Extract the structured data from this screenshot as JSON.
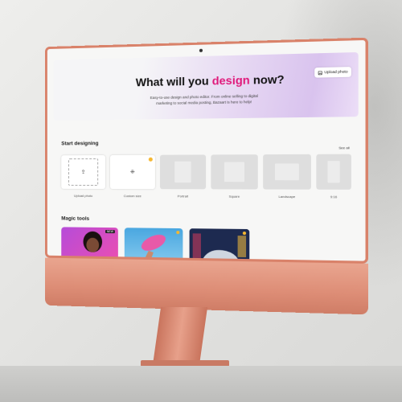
{
  "hero": {
    "title_before": "What will you ",
    "title_accent": "design",
    "title_after": " now?",
    "subtitle": "Easy-to-use design and photo editor. From online selling to digital marketing to social media posting, Bazaart is here to help!",
    "upload_label": "Upload photo"
  },
  "start": {
    "title": "Start designing",
    "see_all": "See all",
    "items": [
      {
        "label": "Upload photo"
      },
      {
        "label": "Custom size"
      },
      {
        "label": "Portrait"
      },
      {
        "label": "Square"
      },
      {
        "label": "Landscape"
      },
      {
        "label": "9:16"
      }
    ]
  },
  "magic": {
    "title": "Magic tools",
    "cards": [
      {
        "tag": "NEW",
        "icon": "person-portrait-magenta"
      },
      {
        "icon": "sneaker-hand-blue"
      },
      {
        "icon": "sneaker-night-street"
      }
    ]
  },
  "colors": {
    "accent": "#e0197a",
    "body": "#dd8d76",
    "badge": "#f5b731"
  }
}
